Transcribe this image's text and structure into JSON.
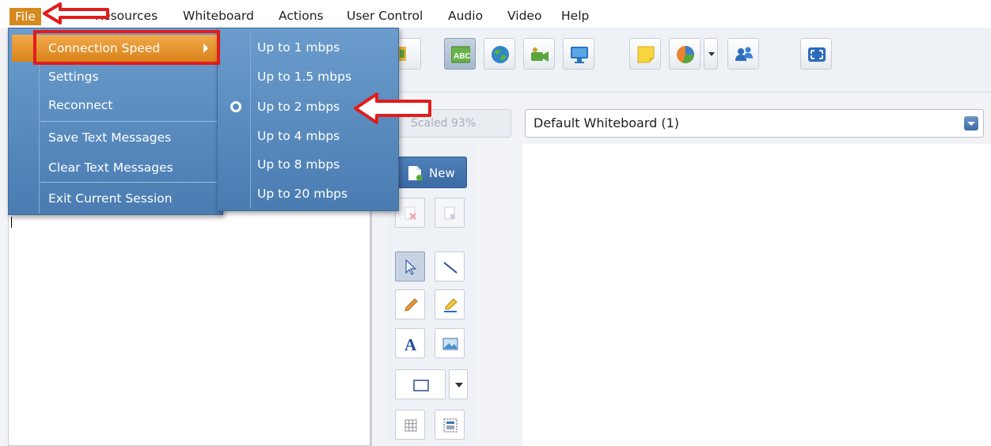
{
  "menubar": {
    "items": [
      "File",
      "Resources",
      "Whiteboard",
      "Actions",
      "User Control",
      "Audio",
      "Video",
      "Help"
    ]
  },
  "file_menu": {
    "items": [
      {
        "label": "Connection Speed",
        "highlighted": true,
        "has_submenu": true
      },
      {
        "label": "Settings"
      },
      {
        "label": "Reconnect"
      },
      {
        "label": "Save Text Messages"
      },
      {
        "label": "Clear Text Messages"
      },
      {
        "label": "Exit Current Session"
      }
    ]
  },
  "connection_speed_submenu": {
    "items": [
      "Up to 1 mbps",
      "Up to 1.5 mbps",
      "Up to 2 mbps",
      "Up to 4 mbps",
      "Up to 8 mbps",
      "Up to 20 mbps"
    ],
    "selected": "Up to 2 mbps"
  },
  "whiteboard": {
    "scale_label": "Scaled 93%",
    "selected_board": "Default Whiteboard (1)",
    "new_button_label": "New"
  },
  "colors": {
    "menu_blue": "#5a8cc2",
    "highlight_orange": "#e8961f",
    "annotation_red": "#e11c1c"
  }
}
